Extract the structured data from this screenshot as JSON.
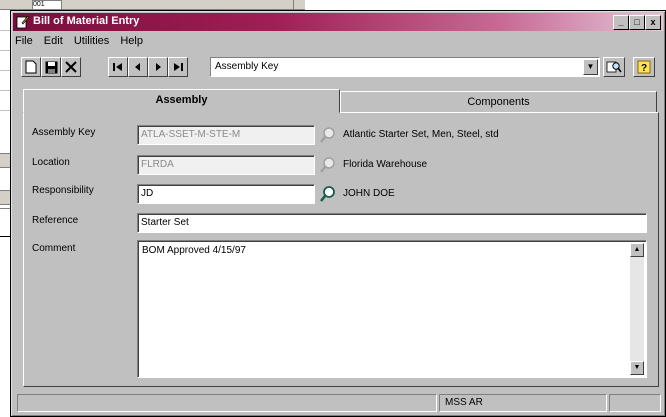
{
  "background_window": {
    "cell_value": "001"
  },
  "window": {
    "title": "Bill of Material Entry",
    "controls": {
      "minimize": "_",
      "maximize": "□",
      "close": "x"
    }
  },
  "menu": [
    "File",
    "Edit",
    "Utilities",
    "Help"
  ],
  "toolbar": {
    "icons": [
      "new-document-icon",
      "save-icon",
      "delete-icon",
      "first-record-icon",
      "previous-record-icon",
      "next-record-icon",
      "last-record-icon"
    ],
    "lookup_combo_value": "Assembly Key"
  },
  "tabs": [
    {
      "label": "Assembly",
      "active": true
    },
    {
      "label": "Components",
      "active": false
    }
  ],
  "form": {
    "assembly_key": {
      "label": "Assembly Key",
      "value": "ATLA-SSET-M-STE-M",
      "description": "Atlantic Starter Set, Men, Steel, std"
    },
    "location": {
      "label": "Location",
      "value": "FLRDA",
      "description": "Florida Warehouse"
    },
    "responsibility": {
      "label": "Responsibility",
      "value": "JD",
      "description": "JOHN DOE"
    },
    "reference": {
      "label": "Reference",
      "value": "Starter Set"
    },
    "comment": {
      "label": "Comment",
      "value": "BOM Approved 4/15/97"
    }
  },
  "statusbar": {
    "user": "MSS AR"
  },
  "colors": {
    "title_start": "#7b0d3c",
    "title_end": "#e6c4d6",
    "face": "#c0c0c0"
  }
}
